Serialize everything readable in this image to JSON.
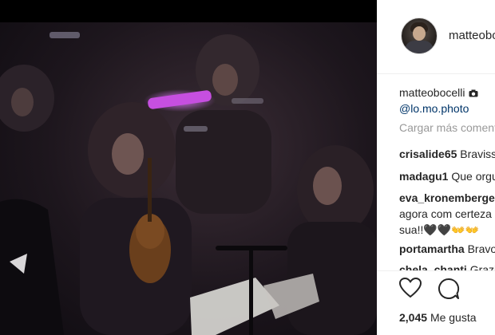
{
  "post": {
    "header_username": "matteobocelli",
    "caption": {
      "username": "matteobocelli",
      "mention": "@lo.mo.photo"
    },
    "load_more": "Cargar más comentarios",
    "comments": [
      {
        "user": "crisalide65",
        "text": "Bravissimo"
      },
      {
        "user": "madagu1",
        "text": "Que orgullo"
      },
      {
        "user": "eva_kronemberger",
        "lines": [
          "agora com certeza",
          "sua!!🖤🖤👐👐"
        ]
      },
      {
        "user": "portamartha",
        "text": "Bravo"
      },
      {
        "user": "chela_chanti",
        "text": "Grazie"
      }
    ],
    "likes_count": "2,045",
    "likes_label": "Me gusta"
  },
  "icons": {
    "camera": "camera-icon",
    "heart": "heart-icon",
    "comment": "comment-icon"
  }
}
